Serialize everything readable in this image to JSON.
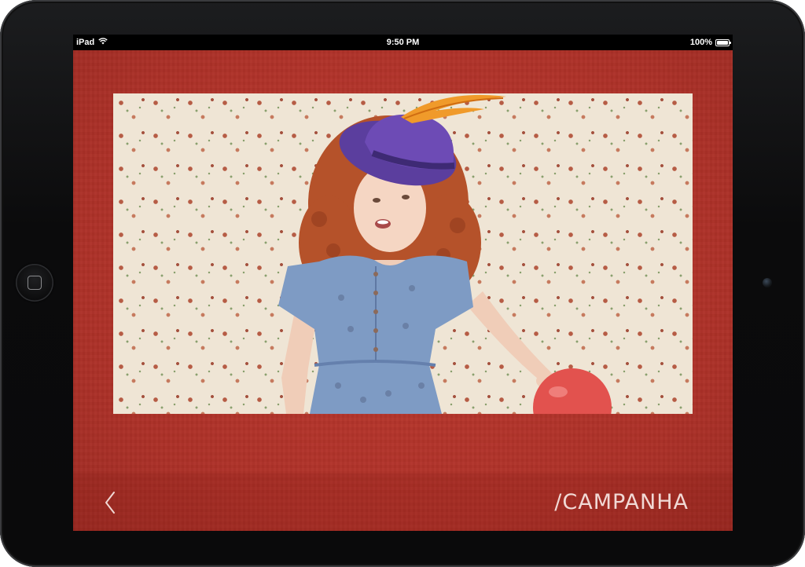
{
  "status_bar": {
    "device": "iPad",
    "time": "9:50 PM",
    "battery": "100%",
    "battery_level": 1.0,
    "wifi_icon": "wifi-icon",
    "battery_icon": "battery-icon"
  },
  "nav": {
    "back_icon": "chevron-left-icon",
    "section_title": "/CAMPANHA"
  },
  "colors": {
    "background": "#b7352d",
    "title_text": "#f1d9d5"
  }
}
